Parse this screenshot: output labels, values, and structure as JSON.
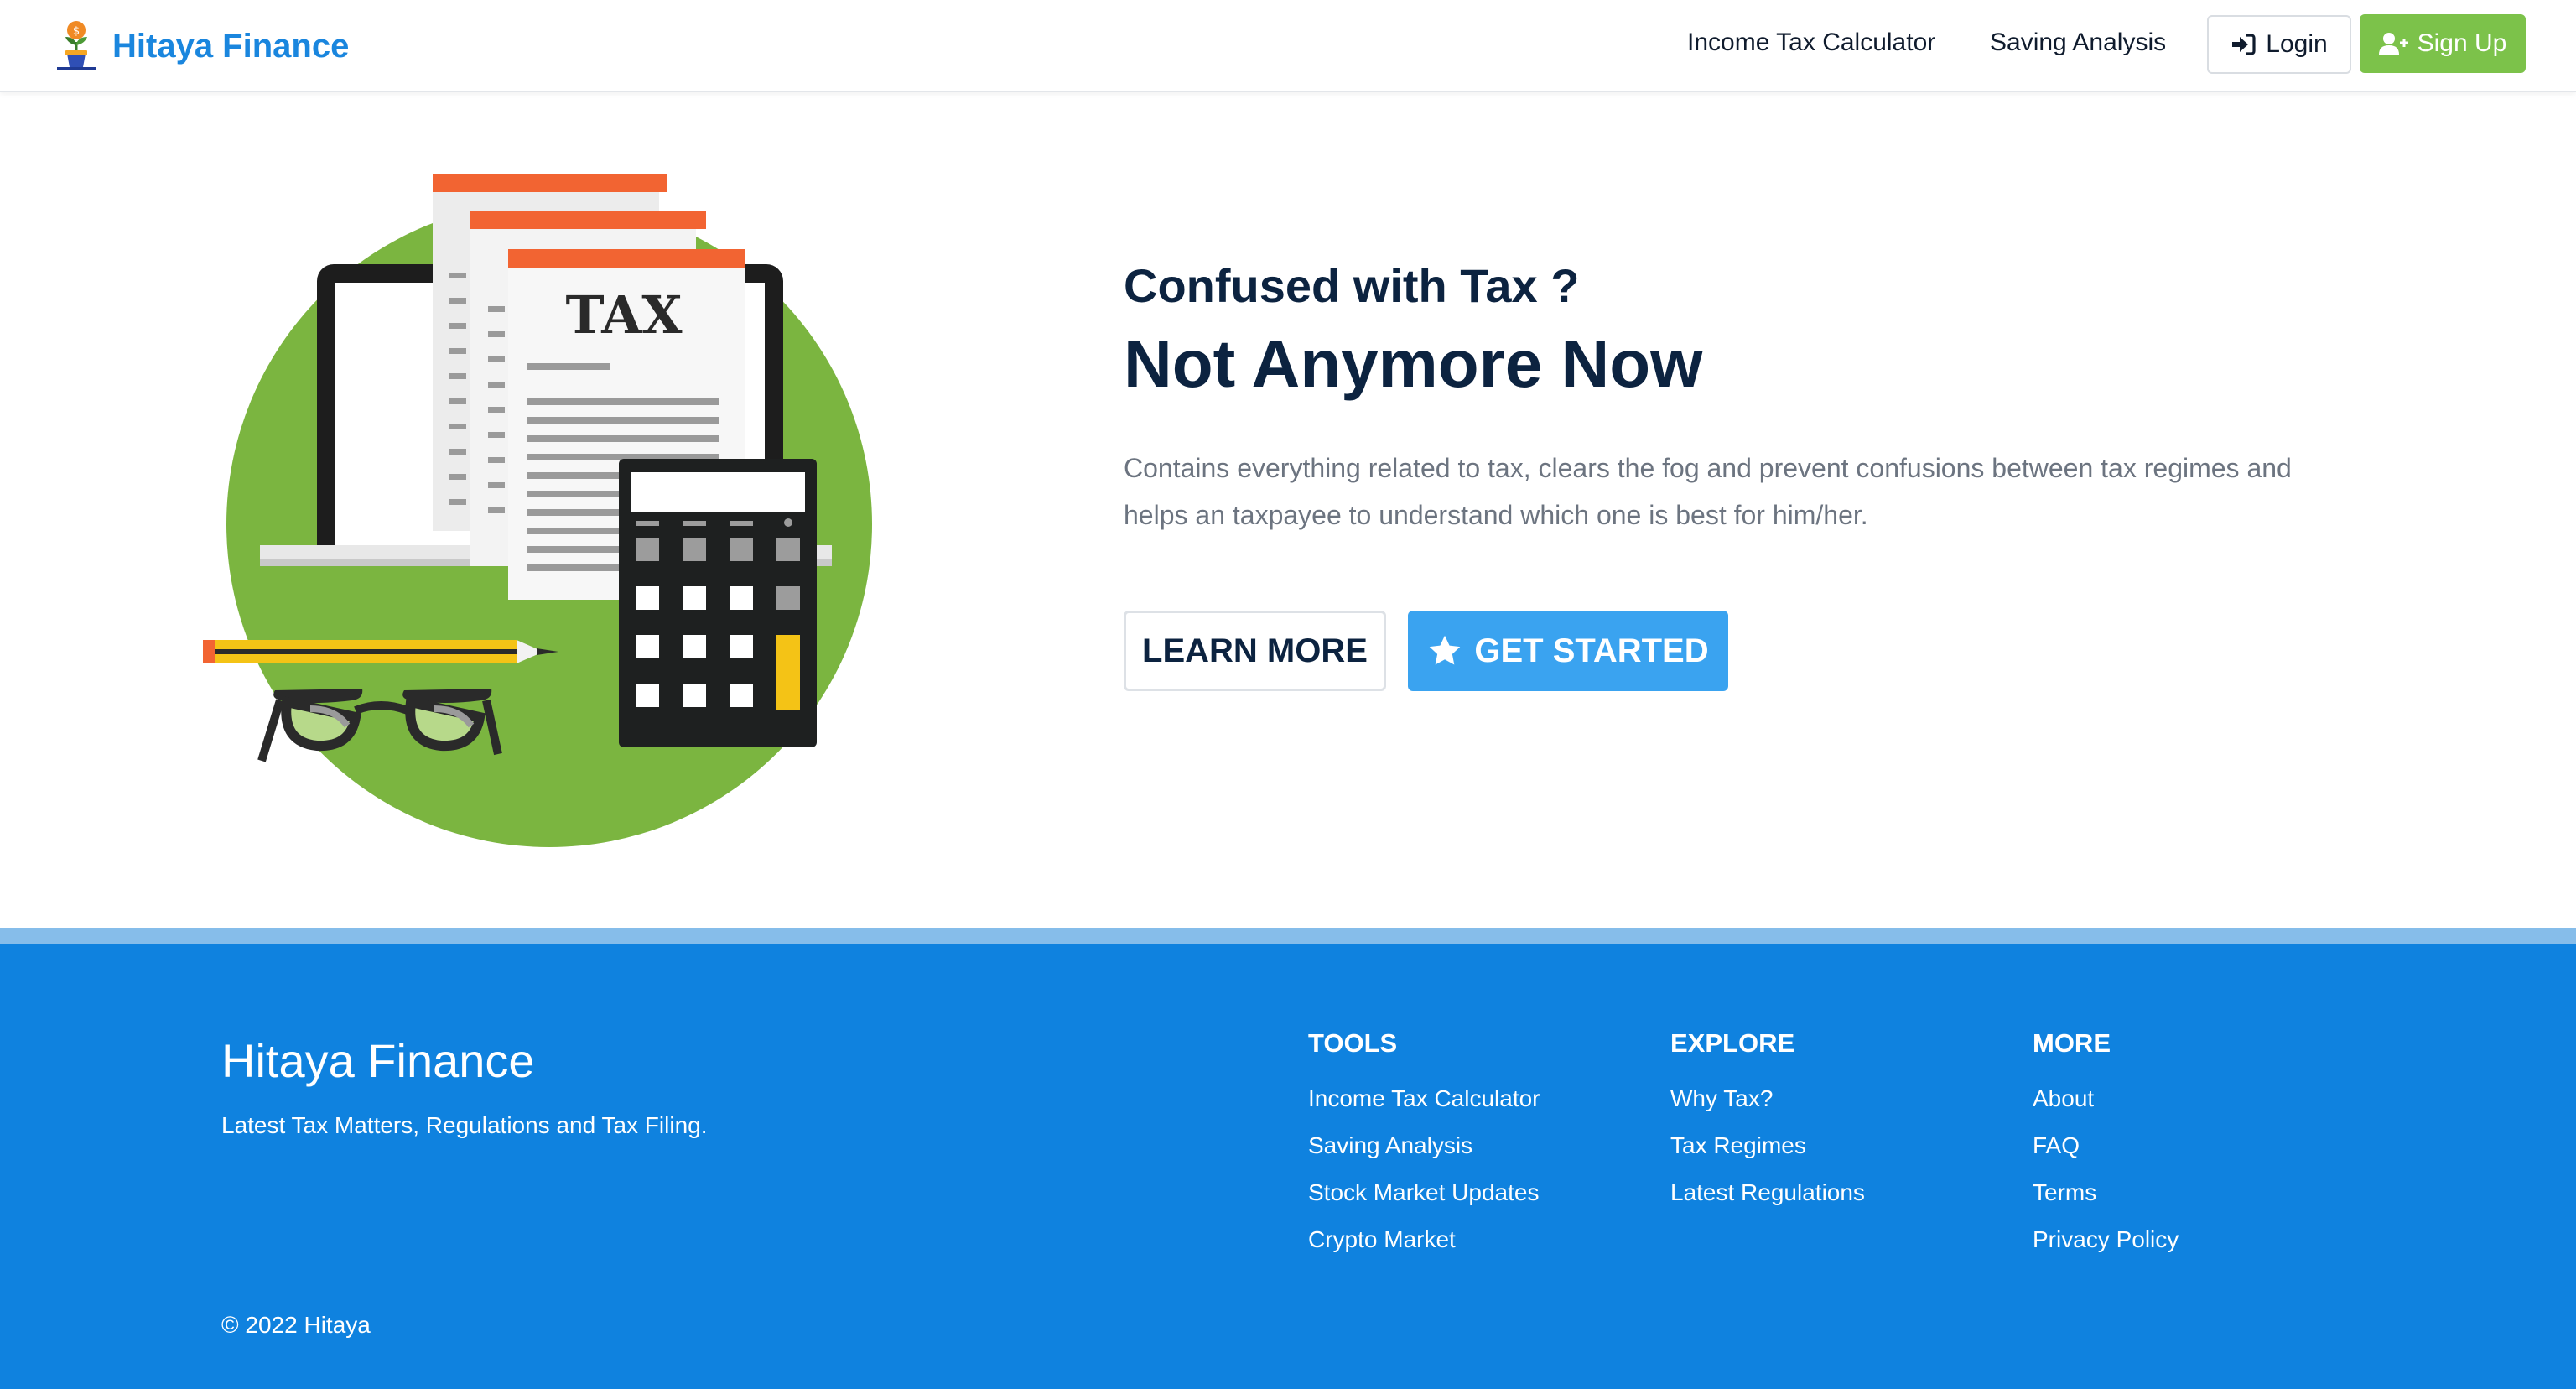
{
  "navbar": {
    "brand": "Hitaya Finance",
    "links": [
      "Income Tax Calculator",
      "Saving Analysis"
    ],
    "login_label": "Login",
    "signup_label": "Sign Up",
    "brand_color": "#1a86de",
    "signup_color": "#7cc24a"
  },
  "hero": {
    "illustration_text": "TAX",
    "subtitle": "Confused with Tax ?",
    "title": "Not Anymore Now",
    "description": "Contains everything related to tax, clears the fog and prevent confusions between tax regimes and helps an taxpayee to understand which one is best for him/her.",
    "learn_more_label": "LEARN MORE",
    "get_started_label": "GET STARTED",
    "accent_color": "#3aa3f0",
    "illustration_circle_color": "#7bb540"
  },
  "footer": {
    "brand": "Hitaya Finance",
    "tagline": "Latest Tax Matters, Regulations and Tax Filing.",
    "background_color": "#0f82df",
    "columns": [
      {
        "heading": "TOOLS",
        "links": [
          "Income Tax Calculator",
          "Saving Analysis",
          "Stock Market Updates",
          "Crypto Market"
        ]
      },
      {
        "heading": "EXPLORE",
        "links": [
          "Why Tax?",
          "Tax Regimes",
          "Latest Regulations"
        ]
      },
      {
        "heading": "MORE",
        "links": [
          "About",
          "FAQ",
          "Terms",
          "Privacy Policy"
        ]
      }
    ],
    "copyright": "© 2022 Hitaya"
  }
}
